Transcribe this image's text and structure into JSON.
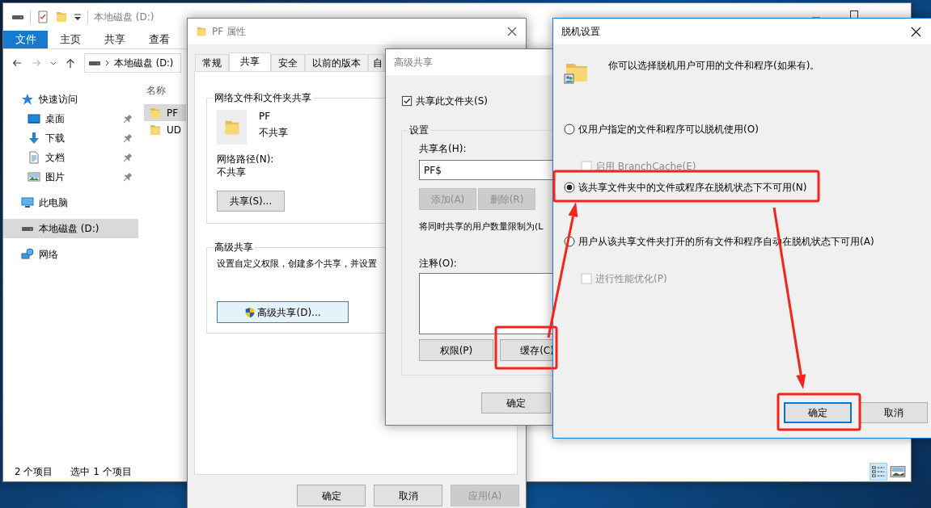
{
  "explorer": {
    "title": "本地磁盘 (D:)",
    "ribbon_tabs": [
      {
        "label": "文件",
        "kind": "file"
      },
      {
        "label": "主页",
        "kind": "tab"
      },
      {
        "label": "共享",
        "kind": "tab"
      },
      {
        "label": "查看",
        "kind": "tab"
      }
    ],
    "address": "本地磁盘 (D:)",
    "nav": [
      {
        "label": "快速访问",
        "kind": "quick",
        "selected": false,
        "children": [
          {
            "label": "桌面",
            "kind": "desktop",
            "pinned": true,
            "selected": false
          },
          {
            "label": "下载",
            "kind": "downloads",
            "pinned": true,
            "selected": false
          },
          {
            "label": "文档",
            "kind": "documents",
            "pinned": true,
            "selected": false
          },
          {
            "label": "图片",
            "kind": "pictures",
            "pinned": true,
            "selected": false
          }
        ]
      },
      {
        "label": "此电脑",
        "kind": "computer",
        "selected": false
      },
      {
        "label": "本地磁盘 (D:)",
        "kind": "drive",
        "selected": true
      },
      {
        "label": "网络",
        "kind": "network",
        "selected": false
      }
    ],
    "column_header": "名称",
    "files": [
      {
        "name": "PF",
        "selected": true
      },
      {
        "name": "UD",
        "selected": false
      }
    ],
    "status": [
      "2 个项目",
      "选中 1 个项目"
    ],
    "view_modes": [
      {
        "kind": "details",
        "selected": true
      },
      {
        "kind": "tiles",
        "selected": false
      }
    ]
  },
  "properties": {
    "title": "PF 属性",
    "tabs": [
      {
        "label": "常规",
        "selected": false
      },
      {
        "label": "共享",
        "selected": true
      },
      {
        "label": "安全",
        "selected": false
      },
      {
        "label": "以前的版本",
        "selected": false
      },
      {
        "label": "自",
        "selected": false
      }
    ],
    "share_group": {
      "title": "网络文件和文件夹共享",
      "name": "PF",
      "state": "不共享",
      "path_label": "网络路径(N):",
      "path": "不共享",
      "button": "共享(S)..."
    },
    "advanced_group": {
      "title": "高级共享",
      "description": "设置自定义权限，创建多个共享，并设置",
      "button": "高级共享(D)..."
    },
    "buttons": [
      {
        "label": "确定",
        "disabled": false
      },
      {
        "label": "取消",
        "disabled": false
      },
      {
        "label": "应用(A)",
        "disabled": true
      }
    ]
  },
  "advanced_share": {
    "title": "高级共享",
    "share_checkbox": {
      "label": "共享此文件夹(S)",
      "checked": true
    },
    "group_title": "设置",
    "share_name_label": "共享名(H):",
    "share_name": "PF$",
    "name_buttons": [
      {
        "label": "添加(A)",
        "disabled": true
      },
      {
        "label": "删除(R)",
        "disabled": true
      }
    ],
    "limit_label": "将同时共享的用户数量限制为(L",
    "comment_label": "注释(O):",
    "lower_buttons": [
      {
        "label": "权限(P)",
        "disabled": false
      },
      {
        "label": "缓存(C)",
        "disabled": false
      }
    ],
    "ok": "确定"
  },
  "offline": {
    "title": "脱机设置",
    "description": "你可以选择脱机用户可用的文件和程序(如果有)。",
    "options": [
      {
        "kind": "radio",
        "label": "仅用户指定的文件和程序可以脱机使用(O)",
        "selected": false
      },
      {
        "kind": "checkbox",
        "label": "启用 BranchCache(E)",
        "checked": false,
        "disabled": true
      },
      {
        "kind": "radio",
        "label": "该共享文件夹中的文件或程序在脱机状态下不可用(N)",
        "selected": true
      },
      {
        "kind": "radio",
        "label": "用户从该共享文件夹打开的所有文件和程序自动在脱机状态下可用(A)",
        "selected": false
      },
      {
        "kind": "checkbox",
        "label": "进行性能优化(P)",
        "checked": false,
        "disabled": true
      }
    ],
    "buttons": [
      {
        "label": "确定",
        "focused": true
      },
      {
        "label": "取消",
        "focused": false
      }
    ]
  }
}
